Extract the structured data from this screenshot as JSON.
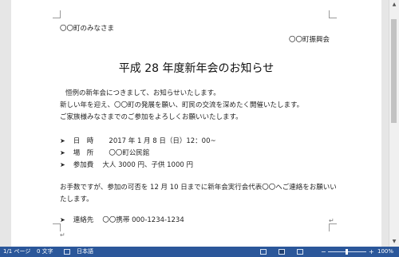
{
  "document": {
    "recipient": "〇〇町のみなさま",
    "sender": "〇〇町振興会",
    "title": "平成 28 年度新年会のお知らせ",
    "body_lines": [
      "恒例の新年会につきまして、お知らせいたします。",
      "新しい年を迎え、〇〇町の発展を願い、町民の交流を深めたく開催いたします。",
      "ご家族様みなさまでのご参加をよろしくお願いいたします。"
    ],
    "details": [
      {
        "label": "日　時",
        "value": "2017 年 1 月 8 日（日）12：00~"
      },
      {
        "label": "場　所",
        "value": "〇〇町公民館"
      },
      {
        "label": "参加費",
        "value": "大人 3000 円、子供 1000 円"
      }
    ],
    "notice_lines": [
      "お手数ですが、参加の可否を 12 月 10 日までに新年会実行会代表〇〇へご連絡をお願いい",
      "たします。"
    ],
    "contact": {
      "label": "連絡先",
      "value": "〇〇携帯 000-1234-1234"
    },
    "bullet": "➤"
  },
  "statusbar": {
    "page": "1/1 ページ",
    "words": "0 文字",
    "language": "日本語",
    "zoom": "100%",
    "zoom_minus": "−",
    "zoom_plus": "+"
  },
  "colors": {
    "statusbar": "#2b579a",
    "workspace": "#e6e6e6"
  }
}
